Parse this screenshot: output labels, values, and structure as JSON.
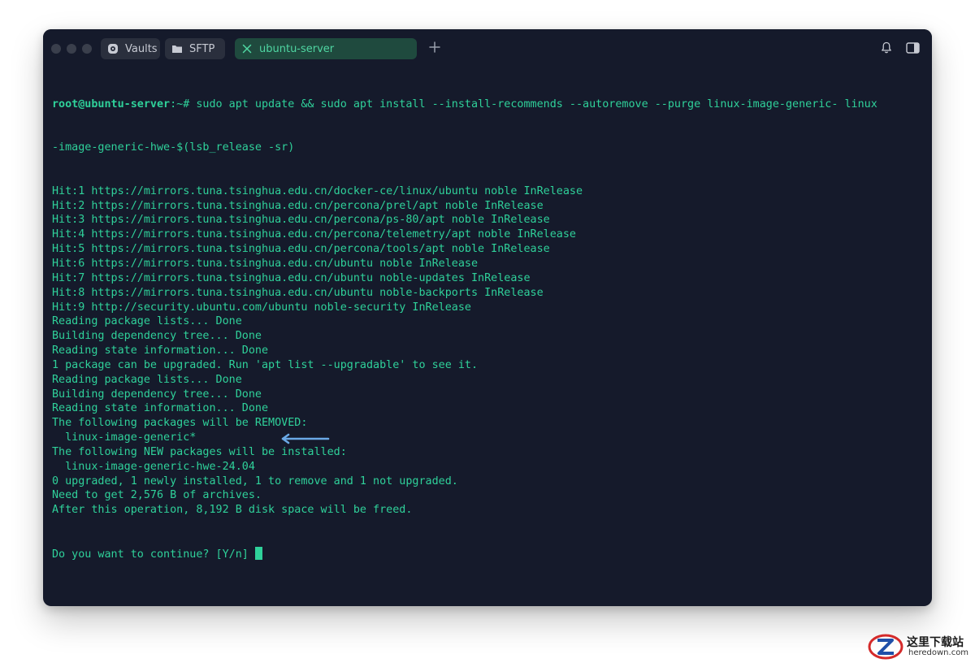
{
  "window": {
    "background": "#151a2b",
    "accent": "#2fd19a"
  },
  "tabs": [
    {
      "label": "Vaults",
      "icon": "vault-icon",
      "active": false
    },
    {
      "label": "SFTP",
      "icon": "folder-icon",
      "active": false
    },
    {
      "label": "ubuntu-server",
      "icon": "close-icon",
      "active": true
    }
  ],
  "toolbar": {
    "new_tab_icon": "plus-icon",
    "notification_icon": "bell-icon",
    "sidebar_toggle_icon": "sidebar-icon"
  },
  "terminal": {
    "prompt_user": "root@ubuntu-server",
    "prompt_path": ":~#",
    "command_line1": " sudo apt update && sudo apt install --install-recommends --autoremove --purge linux-image-generic- linux",
    "command_line2": "-image-generic-hwe-$(lsb_release -sr)",
    "lines": [
      "Hit:1 https://mirrors.tuna.tsinghua.edu.cn/docker-ce/linux/ubuntu noble InRelease",
      "Hit:2 https://mirrors.tuna.tsinghua.edu.cn/percona/prel/apt noble InRelease",
      "Hit:3 https://mirrors.tuna.tsinghua.edu.cn/percona/ps-80/apt noble InRelease",
      "Hit:4 https://mirrors.tuna.tsinghua.edu.cn/percona/telemetry/apt noble InRelease",
      "Hit:5 https://mirrors.tuna.tsinghua.edu.cn/percona/tools/apt noble InRelease",
      "Hit:6 https://mirrors.tuna.tsinghua.edu.cn/ubuntu noble InRelease",
      "Hit:7 https://mirrors.tuna.tsinghua.edu.cn/ubuntu noble-updates InRelease",
      "Hit:8 https://mirrors.tuna.tsinghua.edu.cn/ubuntu noble-backports InRelease",
      "Hit:9 http://security.ubuntu.com/ubuntu noble-security InRelease",
      "Reading package lists... Done",
      "Building dependency tree... Done",
      "Reading state information... Done",
      "1 package can be upgraded. Run 'apt list --upgradable' to see it.",
      "Reading package lists... Done",
      "Building dependency tree... Done",
      "Reading state information... Done",
      "The following packages will be REMOVED:",
      "  linux-image-generic*",
      "The following NEW packages will be installed:",
      "  linux-image-generic-hwe-24.04",
      "0 upgraded, 1 newly installed, 1 to remove and 1 not upgraded.",
      "Need to get 2,576 B of archives.",
      "After this operation, 8,192 B disk space will be freed."
    ],
    "final_prompt": "Do you want to continue? [Y/n] "
  },
  "annotation": {
    "arrow_color": "#6aa9e6"
  },
  "watermark": {
    "title": "这里下载站",
    "subtitle": "heredown.com"
  }
}
